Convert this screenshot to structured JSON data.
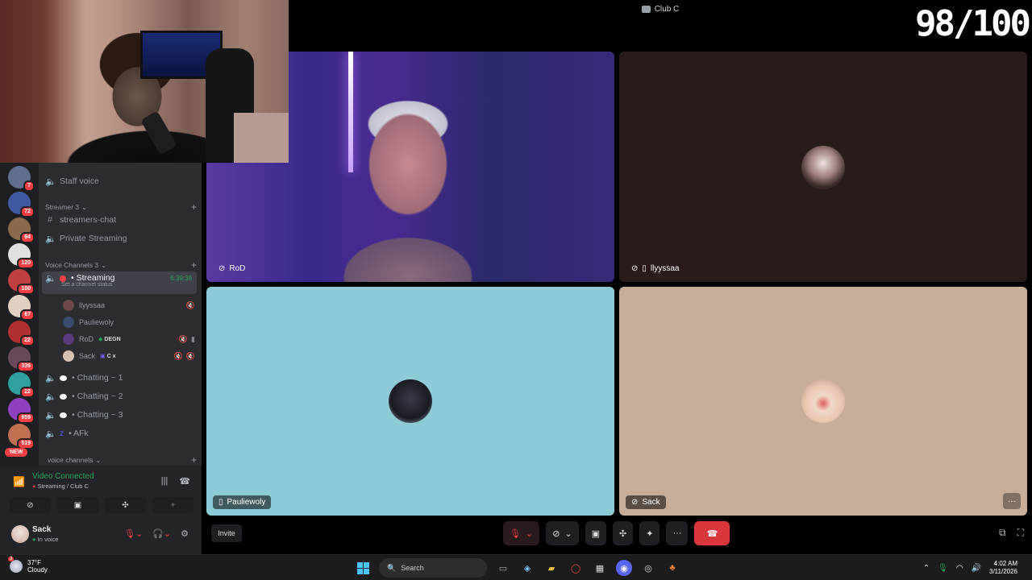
{
  "window": {
    "title": "Club C"
  },
  "overlay": {
    "counter": "98/100"
  },
  "rail": {
    "servers": [
      {
        "badge": "7",
        "color": "#5f6f8f"
      },
      {
        "badge": "72",
        "color": "#3f5aa0"
      },
      {
        "badge": "94",
        "color": "#8a6a4a"
      },
      {
        "badge": "120",
        "color": "#e0e0e0"
      },
      {
        "badge": "100",
        "color": "#c04040"
      },
      {
        "badge": "67",
        "color": "#e0d0c0"
      },
      {
        "badge": "22",
        "color": "#b03030"
      },
      {
        "badge": "336",
        "color": "#6a4a5a"
      },
      {
        "badge": "22",
        "color": "#30a0a0"
      },
      {
        "badge": "959",
        "color": "#9040c0"
      },
      {
        "badge": "519",
        "color": "#c07050"
      }
    ],
    "new_label": "NEW"
  },
  "sidebar": {
    "channels_top": [
      {
        "name": "Staff voice",
        "icon": "speaker-icon"
      }
    ],
    "streamer_category": "Streamer 3",
    "streamer_channels": [
      {
        "name": "streamers-chat",
        "icon": "hash-icon"
      },
      {
        "name": "Private Streaming",
        "icon": "speaker-icon"
      }
    ],
    "voice_category": "Voice Channels 3",
    "active_channel": {
      "name": "• Streaming",
      "status": "Set a channel status",
      "timer": "6:39:39"
    },
    "members": [
      {
        "name": "llyyssaa",
        "tag": "",
        "color": "#6a4a4a"
      },
      {
        "name": "Pauliewoly",
        "tag": "",
        "color": "#3a4a6a"
      },
      {
        "name": "RoD",
        "tag": "DEGN",
        "color": "#5a3a7a"
      },
      {
        "name": "Sack",
        "tag": "C x",
        "color": "#d8c0b0"
      }
    ],
    "voice_channels": [
      {
        "name": "• Chatting ~ 1"
      },
      {
        "name": "• Chatting ~ 2"
      },
      {
        "name": "• Chatting ~ 3"
      },
      {
        "name": "• AFk"
      }
    ],
    "voice_channels_category": "voice channels"
  },
  "voice_panel": {
    "title": "Video Connected",
    "subtitle": "Streaming / Club C"
  },
  "user_panel": {
    "name": "Sack",
    "status": "In voice"
  },
  "tiles": [
    {
      "name": "RoD",
      "label_icon": "speaker-off-icon"
    },
    {
      "name": "llyyssaa",
      "label_icon": "phone-icon",
      "bg": "#291b1a"
    },
    {
      "name": "Pauliewoly",
      "label_icon": "phone-icon",
      "bg": "#8ecbd6"
    },
    {
      "name": "Sack",
      "label_icon": "speaker-off-icon",
      "bg": "#c8ae98"
    }
  ],
  "toolbar": {
    "invite": "Invite"
  },
  "taskbar": {
    "weather_temp": "37°F",
    "weather_desc": "Cloudy",
    "weather_badge": "3",
    "search": "Search",
    "time": "4:02 AM",
    "date": "3/11/2026"
  },
  "colors": {
    "accent_green": "#23a55a",
    "danger_red": "#f23f43",
    "sidebar_bg": "#2b2d31"
  }
}
